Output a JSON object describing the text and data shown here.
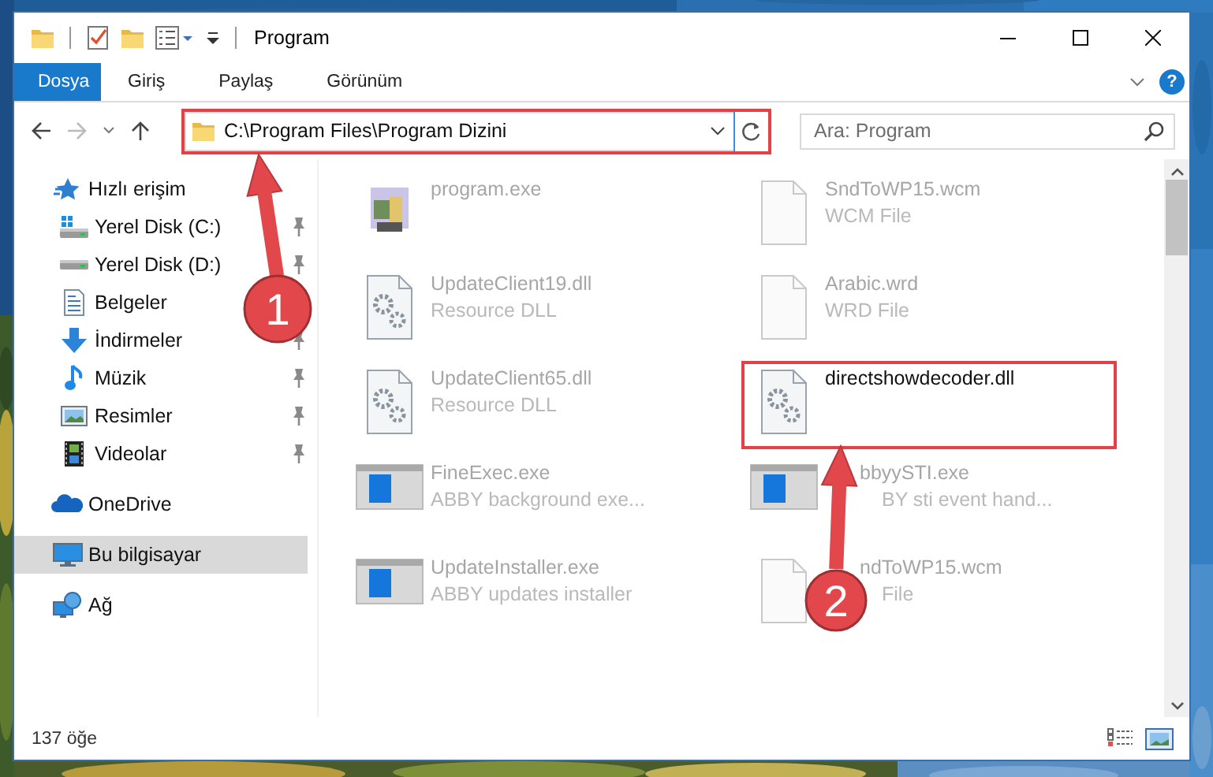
{
  "window": {
    "title": "Program"
  },
  "ribbon": {
    "tabs": [
      {
        "label": "Dosya",
        "kind": "file",
        "selected": false
      },
      {
        "label": "Giriş",
        "kind": "tab",
        "selected": false
      },
      {
        "label": "Paylaş",
        "kind": "tab",
        "selected": false
      },
      {
        "label": "Görünüm",
        "kind": "tab",
        "selected": false
      }
    ],
    "help": "?"
  },
  "address_bar": {
    "path": "C:\\Program Files\\Program Dizini",
    "highlighted": true
  },
  "search": {
    "placeholder": "Ara: Program"
  },
  "sidebar": {
    "items": [
      {
        "label": "Hızlı erişim",
        "kind": "star",
        "selected": false,
        "children": [
          {
            "label": "Yerel Disk (C:)",
            "kind": "system-drive",
            "pinned": true,
            "selected": false
          },
          {
            "label": "Yerel Disk (D:)",
            "kind": "drive",
            "pinned": true,
            "selected": false
          },
          {
            "label": "Belgeler",
            "kind": "documents",
            "selected": false
          },
          {
            "label": "İndirmeler",
            "kind": "downloads",
            "pinned": true,
            "selected": false
          },
          {
            "label": "Müzik",
            "kind": "music",
            "pinned": true,
            "selected": false
          },
          {
            "label": "Resimler",
            "kind": "pictures",
            "pinned": true,
            "selected": false
          },
          {
            "label": "Videolar",
            "kind": "videos",
            "pinned": true,
            "selected": false
          }
        ]
      },
      {
        "label": "OneDrive",
        "kind": "cloud",
        "selected": false
      },
      {
        "label": "Bu bilgisayar",
        "kind": "computer",
        "selected": true
      },
      {
        "label": "Ağ",
        "kind": "network",
        "selected": false
      }
    ]
  },
  "files": [
    {
      "name": "program.exe",
      "kind": "app",
      "highlighted": false
    },
    {
      "name": "SndToWP15.wcm",
      "type": "WCM File",
      "kind": "blank",
      "highlighted": false
    },
    {
      "name": "UpdateClient19.dll",
      "type": "Resource DLL",
      "kind": "gear",
      "highlighted": false
    },
    {
      "name": "Arabic.wrd",
      "type": "WRD File",
      "kind": "blank",
      "highlighted": false
    },
    {
      "name": "UpdateClient65.dll",
      "type": "Resource DLL",
      "kind": "gear",
      "highlighted": false
    },
    {
      "name": "directshowdecoder.dll",
      "kind": "gear",
      "highlighted": true
    },
    {
      "name": "FineExec.exe",
      "type": "ABBY background exe...",
      "kind": "window",
      "highlighted": false
    },
    {
      "name": "bbyySTI.exe",
      "type": "BY sti event hand...",
      "kind": "window",
      "highlighted": false,
      "name_covered": true,
      "type_covered": true
    },
    {
      "name": "UpdateInstaller.exe",
      "type": "ABBY updates installer",
      "kind": "window",
      "highlighted": false
    },
    {
      "name": "ndToWP15.wcm",
      "type": "File",
      "kind": "blank",
      "highlighted": false,
      "name_covered": true,
      "type_covered": true
    }
  ],
  "status_bar": {
    "item_count": "137 öğe"
  },
  "annotations": [
    {
      "number": "1"
    },
    {
      "number": "2"
    }
  ]
}
